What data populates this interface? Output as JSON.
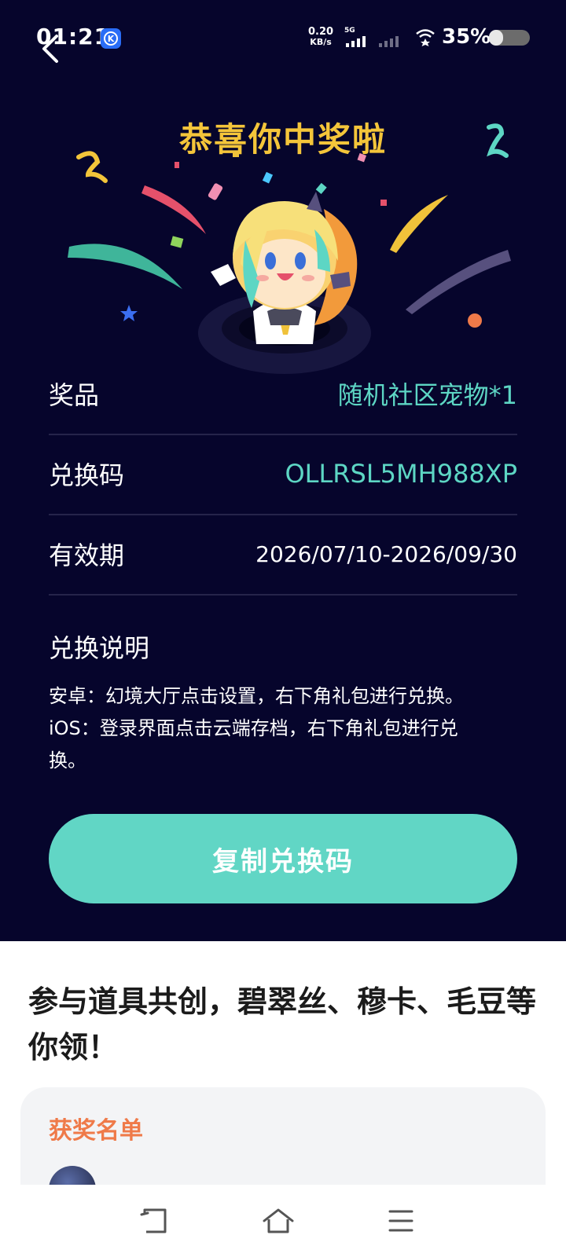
{
  "status_bar": {
    "time": "01:21",
    "network_speed_value": "0.20",
    "network_speed_unit": "KB/s",
    "network_type": "5G",
    "battery": "35%",
    "battery_level": 0.35,
    "icons": [
      "app-k-icon",
      "signal-icon",
      "signal-weak-icon",
      "wifi-icon",
      "battery-icon"
    ]
  },
  "header": {
    "back_icon": "back-arrow-icon"
  },
  "hero": {
    "title": "恭喜你中奖啦"
  },
  "prize_details": {
    "rows": [
      {
        "label": "奖品",
        "value": "随机社区宠物*1"
      },
      {
        "label": "兑换码",
        "value": "OLLRSL5MH988XP"
      },
      {
        "label": "有效期",
        "value": "2026/07/10-2026/09/30"
      }
    ],
    "instructions_title": "兑换说明",
    "instructions_lines": [
      "安卓：幻境大厅点击设置，右下角礼包进行兑换。",
      "iOS：登录界面点击云端存档，右下角礼包进行兑",
      "换。"
    ]
  },
  "actions": {
    "copy_label": "复制兑换码"
  },
  "promo": {
    "title": "参与道具共创，碧翠丝、穆卡、毛豆等你领！",
    "winners_title": "获奖名单"
  },
  "nav_bar": {
    "icons": [
      "back-nav-icon",
      "home-icon",
      "menu-icon"
    ]
  },
  "colors": {
    "panel_bg": "#06052c",
    "accent_teal": "#5dd6c4",
    "title_gold": "#f4c53a",
    "winners_orange": "#ef7a49"
  }
}
